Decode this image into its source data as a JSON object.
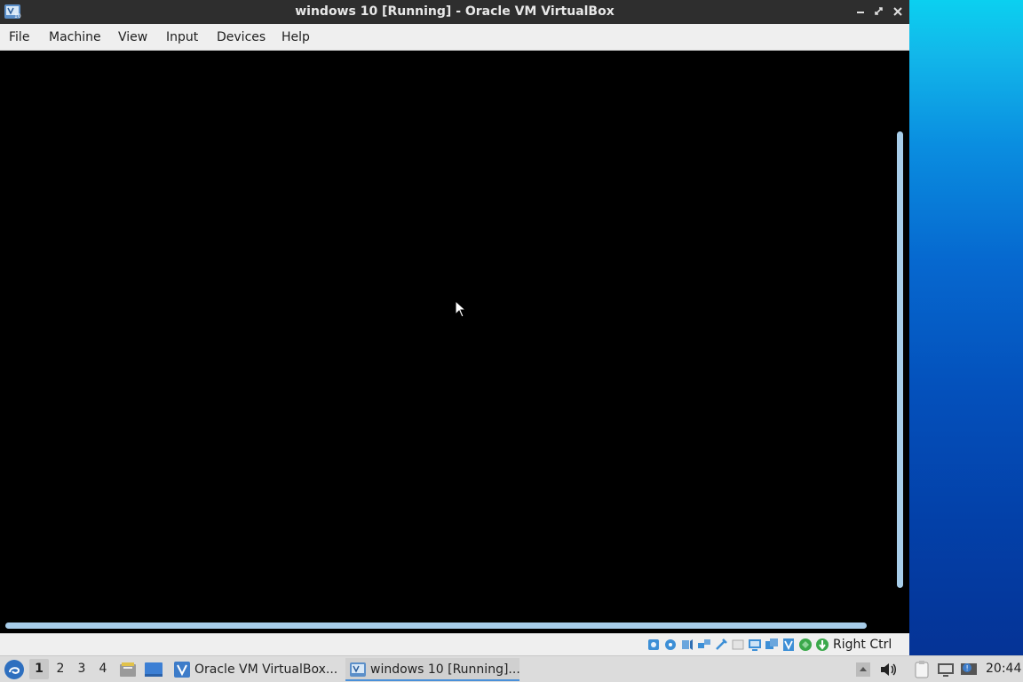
{
  "window": {
    "title": "windows 10 [Running] - Oracle VM VirtualBox",
    "minimize_icon": "minimize-icon",
    "maximize_icon": "maximize-icon",
    "close_icon": "close-icon"
  },
  "menubar": {
    "items": [
      "File",
      "Machine",
      "View",
      "Input",
      "Devices",
      "Help"
    ]
  },
  "statusbar": {
    "icons": [
      "hard-disk-icon",
      "optical-drive-icon",
      "audio-icon",
      "network-icon",
      "usb-icon",
      "shared-folders-icon",
      "display-icon",
      "video-capture-icon",
      "virtualization-icon",
      "mouse-integration-icon",
      "keyboard-capture-icon"
    ],
    "host_key": "Right Ctrl"
  },
  "taskbar": {
    "workspaces": [
      "1",
      "2",
      "3",
      "4"
    ],
    "active_workspace": "1",
    "tasks": [
      {
        "label": "Oracle VM VirtualBox...",
        "active": false
      },
      {
        "label": "windows 10 [Running]...",
        "active": true
      }
    ],
    "clock": "20:44"
  },
  "colors": {
    "titlebar": "#2e2e2e",
    "accent": "#4a90d9",
    "scrollbar": "#a7cde9"
  }
}
